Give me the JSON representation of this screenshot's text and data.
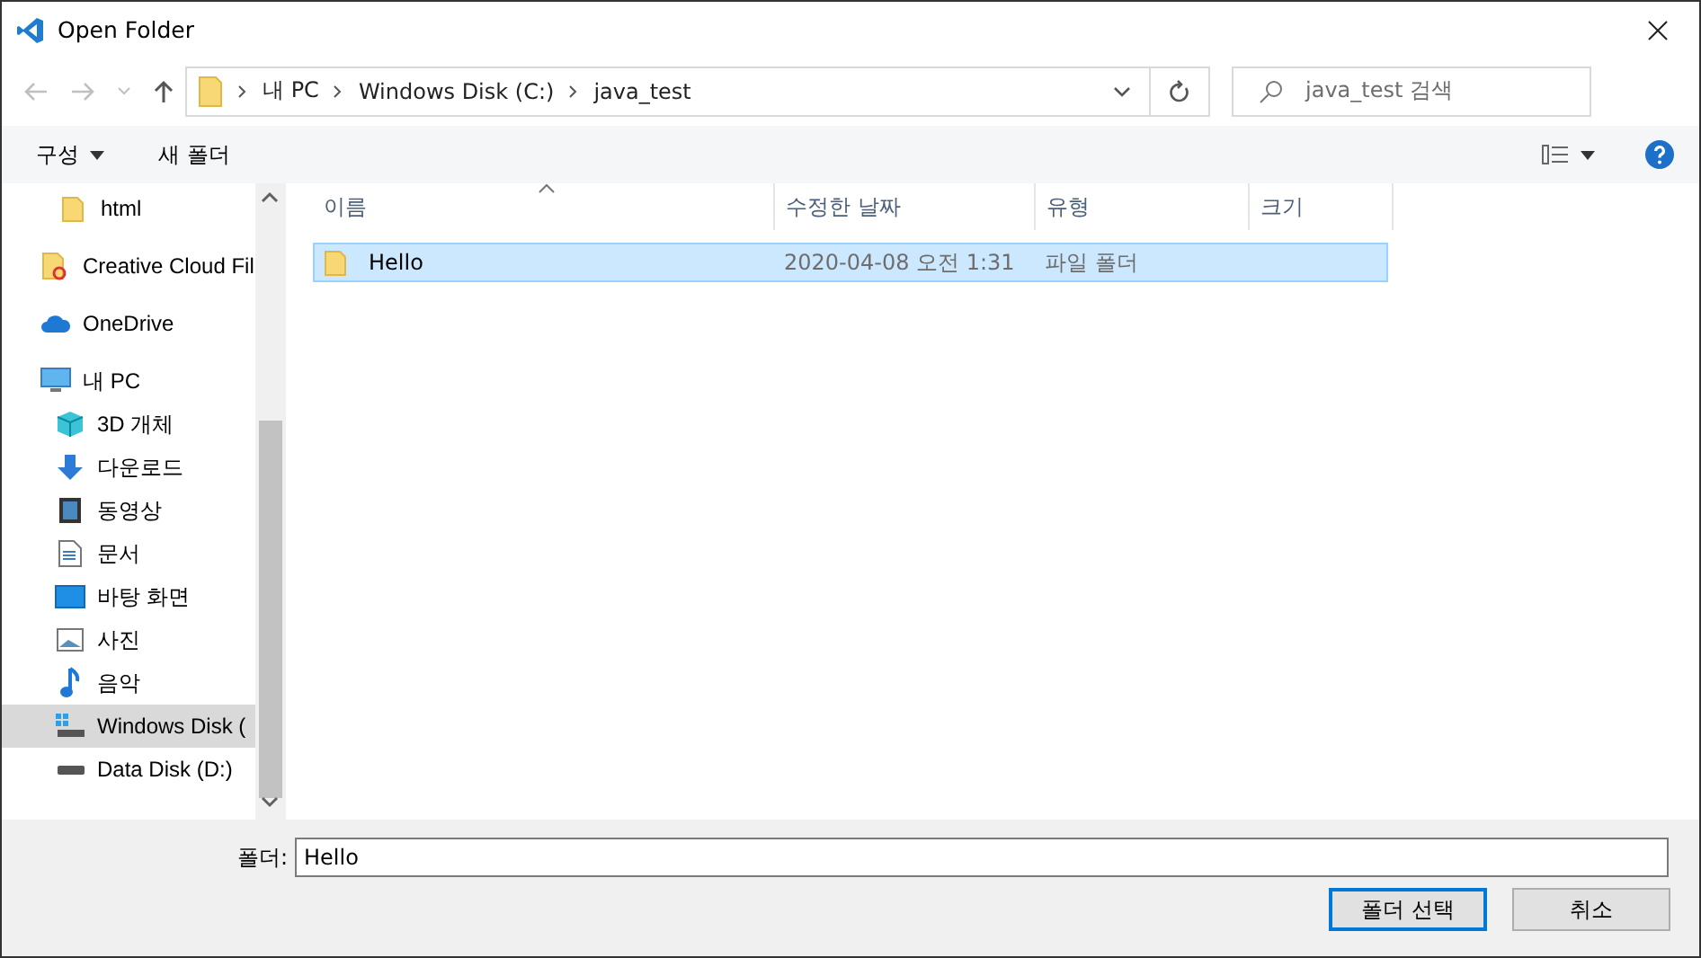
{
  "window": {
    "title": "Open Folder"
  },
  "address": {
    "segments": [
      "내 PC",
      "Windows Disk (C:)",
      "java_test"
    ]
  },
  "search": {
    "placeholder": "java_test 검색"
  },
  "toolbar": {
    "organize": "구성",
    "new_folder": "새 폴더"
  },
  "sidebar": {
    "items": [
      {
        "label": "html",
        "kind": "folder",
        "selected": false
      },
      {
        "label": "Creative Cloud Fil",
        "kind": "cloud-folder",
        "selected": false
      },
      {
        "label": "OneDrive",
        "kind": "onedrive",
        "selected": false
      },
      {
        "label": "내 PC",
        "kind": "pc",
        "selected": false,
        "children": [
          {
            "label": "3D 개체",
            "kind": "cube",
            "selected": false
          },
          {
            "label": "다운로드",
            "kind": "download",
            "selected": false
          },
          {
            "label": "동영상",
            "kind": "video",
            "selected": false
          },
          {
            "label": "문서",
            "kind": "document",
            "selected": false
          },
          {
            "label": "바탕 화면",
            "kind": "desktop",
            "selected": false
          },
          {
            "label": "사진",
            "kind": "picture",
            "selected": false
          },
          {
            "label": "음악",
            "kind": "music",
            "selected": false
          },
          {
            "label": "Windows Disk (",
            "kind": "system-drive",
            "selected": true
          },
          {
            "label": "Data Disk (D:)",
            "kind": "drive",
            "selected": false
          }
        ]
      }
    ]
  },
  "table": {
    "columns": [
      "이름",
      "수정한 날짜",
      "유형",
      "크기"
    ],
    "rows": [
      {
        "name": "Hello",
        "modified": "2020-04-08 오전 1:31",
        "type": "파일 폴더",
        "selected": true
      }
    ]
  },
  "footer": {
    "folder_label": "폴더:",
    "folder_value": "Hello",
    "buttons": [
      {
        "label": "폴더 선택",
        "kind": "primary"
      },
      {
        "label": "취소",
        "kind": "normal"
      }
    ]
  }
}
